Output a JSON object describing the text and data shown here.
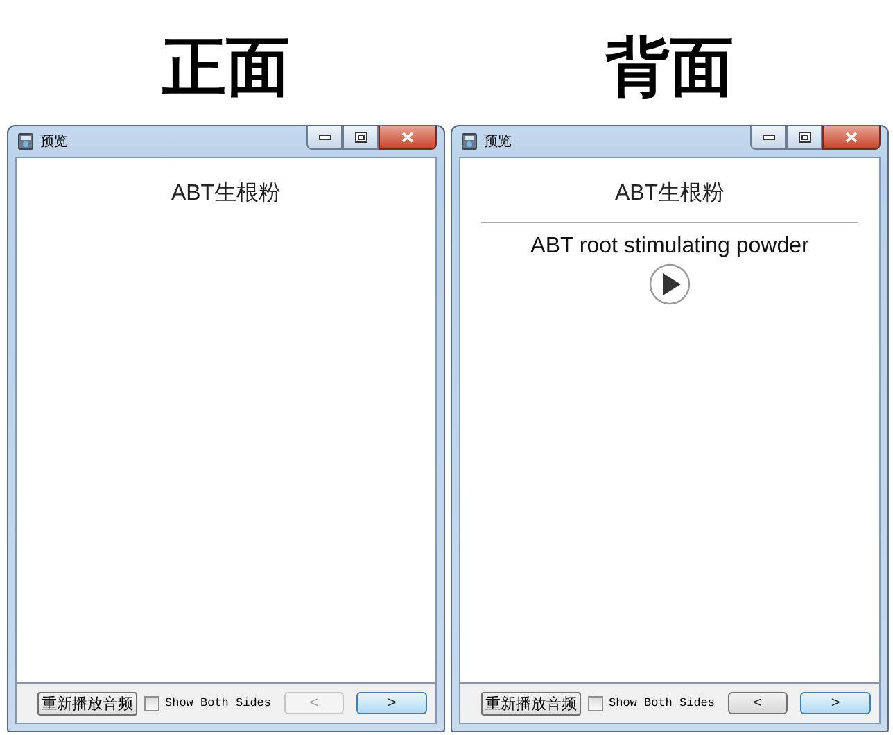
{
  "panels": [
    {
      "heading": "正面",
      "window": {
        "title": "预览"
      },
      "question": "ABT生根粉",
      "replay_button": "重新播放音频",
      "show_both": {
        "label": "Show Both Sides",
        "checked": false
      },
      "prev": {
        "label": "<",
        "disabled": true
      },
      "next": {
        "label": ">",
        "disabled": false
      }
    },
    {
      "heading": "背面",
      "window": {
        "title": "预览"
      },
      "question": "ABT生根粉",
      "answer": {
        "text": "ABT root stimulating powder",
        "audio": true
      },
      "replay_button": "重新播放音频",
      "show_both": {
        "label": "Show Both Sides",
        "checked": false
      },
      "prev": {
        "label": "<",
        "disabled": false
      },
      "next": {
        "label": ">",
        "disabled": false
      }
    }
  ]
}
